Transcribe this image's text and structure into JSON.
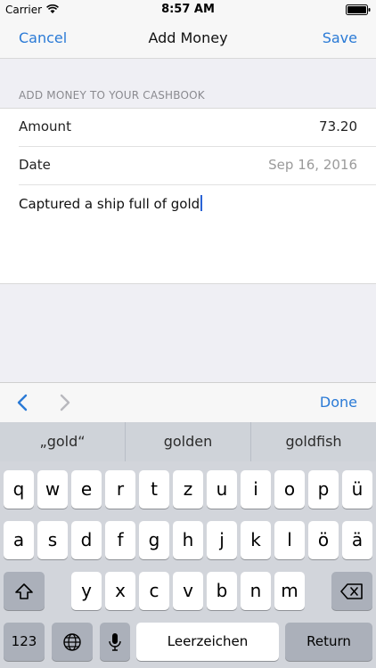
{
  "status_bar": {
    "carrier": "Carrier",
    "time": "8:57 AM"
  },
  "nav": {
    "cancel": "Cancel",
    "title": "Add Money",
    "save": "Save",
    "accent": "#2a7ad6"
  },
  "section_header": "ADD MONEY TO YOUR CASHBOOK",
  "form": {
    "amount_label": "Amount",
    "amount_value": "73.20",
    "date_label": "Date",
    "date_value": "Sep 16, 2016",
    "note_text": "Captured a ship full of gold"
  },
  "accessory": {
    "prev_icon": "chevron-left-icon",
    "next_icon": "chevron-right-icon",
    "done": "Done"
  },
  "suggestions": [
    "„gold“",
    "golden",
    "goldfish"
  ],
  "keyboard": {
    "row1": [
      "q",
      "w",
      "e",
      "r",
      "t",
      "z",
      "u",
      "i",
      "o",
      "p",
      "ü"
    ],
    "row2": [
      "a",
      "s",
      "d",
      "f",
      "g",
      "h",
      "j",
      "k",
      "l",
      "ö",
      "ä"
    ],
    "row3": [
      "y",
      "x",
      "c",
      "v",
      "b",
      "n",
      "m"
    ],
    "numbers": "123",
    "space": "Leerzeichen",
    "return": "Return"
  }
}
